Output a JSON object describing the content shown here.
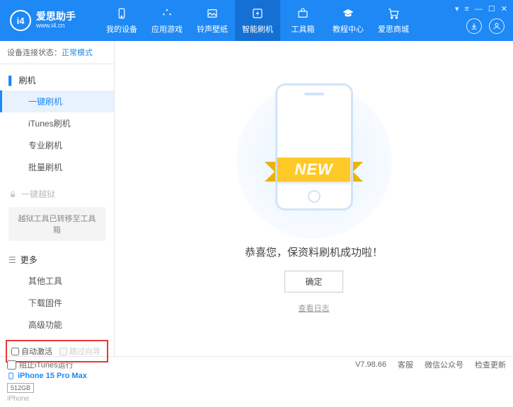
{
  "logo": {
    "badge": "i4",
    "title": "爱思助手",
    "subtitle": "www.i4.cn"
  },
  "nav": {
    "items": [
      {
        "label": "我的设备"
      },
      {
        "label": "应用游戏"
      },
      {
        "label": "铃声壁纸"
      },
      {
        "label": "智能刷机"
      },
      {
        "label": "工具箱"
      },
      {
        "label": "教程中心"
      },
      {
        "label": "爱思商城"
      }
    ]
  },
  "status": {
    "prefix": "设备连接状态：",
    "mode": "正常模式"
  },
  "sidebar": {
    "flash_header": "刷机",
    "flash_items": [
      "一键刷机",
      "iTunes刷机",
      "专业刷机",
      "批量刷机"
    ],
    "jailbreak_header": "一键越狱",
    "jailbreak_note": "越狱工具已转移至工具箱",
    "more_header": "更多",
    "more_items": [
      "其他工具",
      "下载固件",
      "高级功能"
    ]
  },
  "options": {
    "auto_activate": "自动激活",
    "skip_guide": "跳过向导"
  },
  "device": {
    "name": "iPhone 15 Pro Max",
    "storage": "512GB",
    "type": "iPhone"
  },
  "main": {
    "ribbon": "NEW",
    "success": "恭喜您，保资料刷机成功啦！",
    "ok": "确定",
    "log": "查看日志"
  },
  "footer": {
    "block_itunes": "阻止iTunes运行",
    "version": "V7.98.66",
    "support": "客服",
    "wechat": "微信公众号",
    "update": "检查更新"
  }
}
